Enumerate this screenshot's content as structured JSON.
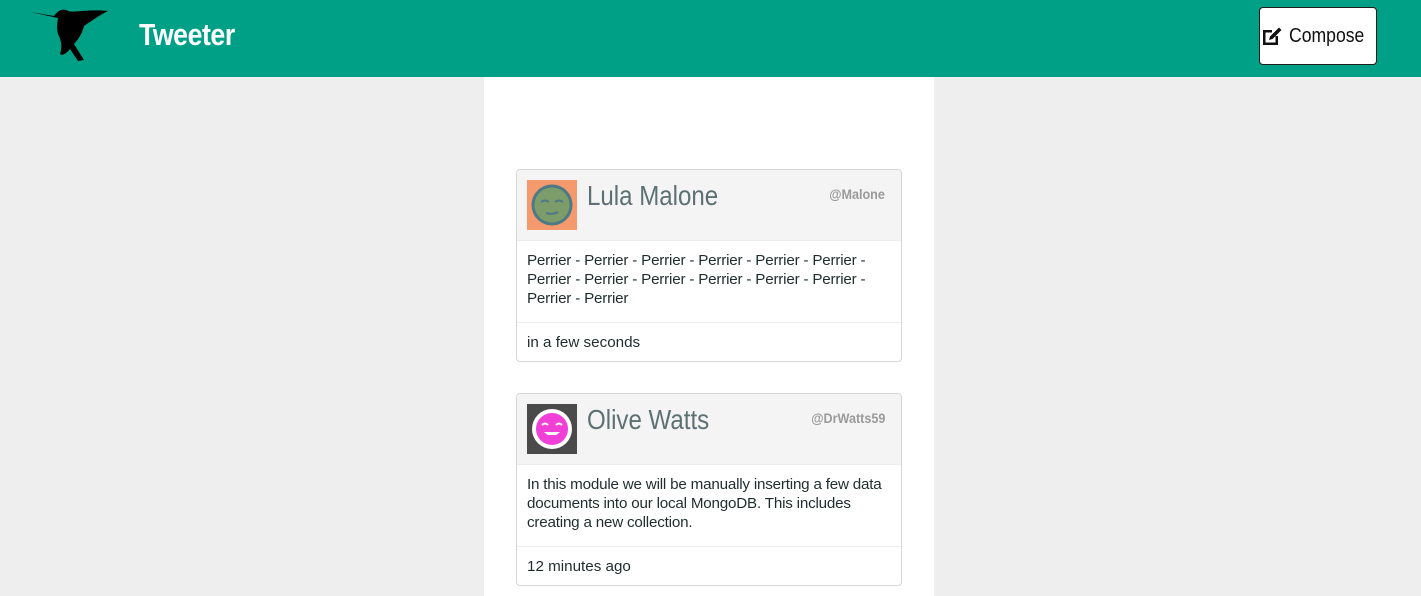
{
  "colors": {
    "navbar": "#00a087",
    "background": "#eeeeee",
    "name_text": "#5d7072",
    "handle_text": "#9a9a9a"
  },
  "header": {
    "logo_icon": "hummingbird-icon",
    "brand": "Tweeter",
    "compose_icon": "edit-icon",
    "compose_label": "Compose"
  },
  "tweets": [
    {
      "name": "Lula Malone",
      "handle": "@Malone",
      "avatar_icon": "sleepy-face-avatar",
      "avatar_bg": "#f59a6d",
      "body": "Perrier - Perrier - Perrier - Perrier - Perrier - Perrier - Perrier - Perrier - Perrier - Perrier - Perrier - Perrier - Perrier - Perrier",
      "time": "in a few seconds"
    },
    {
      "name": "Olive Watts",
      "handle": "@DrWatts59",
      "avatar_icon": "happy-face-avatar",
      "avatar_bg": "#4a4a4a",
      "body": "In this module we will be manually inserting a few data documents into our local MongoDB. This includes creating a new collection.",
      "time": "12 minutes ago"
    }
  ]
}
